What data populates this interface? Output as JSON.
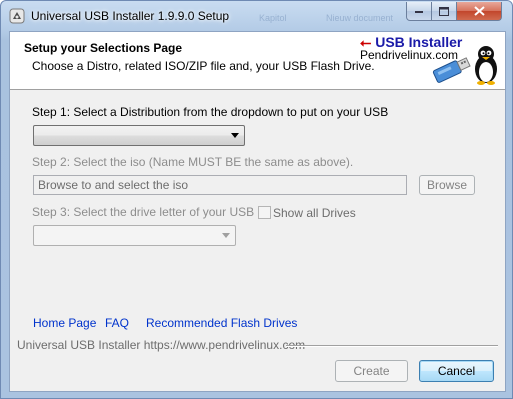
{
  "window": {
    "title": "Universal USB Installer 1.9.9.0 Setup",
    "background_ghost": [
      "Kapitol",
      "Nieuw document"
    ]
  },
  "header": {
    "title": "Setup your Selections Page",
    "subtitle": "Choose a Distro, related ISO/ZIP file and, your USB Flash Drive.",
    "brand_title": "USB Installer",
    "brand_site": "Pendrivelinux.com"
  },
  "step1": {
    "label": "Step 1: Select a Distribution from the dropdown to put on your USB",
    "selected": ""
  },
  "step2": {
    "label": "Step 2: Select the iso (Name MUST BE the same as above).",
    "iso_placeholder": "Browse to and select the iso",
    "browse_label": "Browse"
  },
  "step3": {
    "label": "Step 3: Select the drive letter of your USB",
    "show_all_label": "Show all Drives",
    "selected": ""
  },
  "links": {
    "home": "Home Page",
    "faq": "FAQ",
    "recommended": "Recommended Flash Drives"
  },
  "footer": {
    "branding": "Universal USB Installer https://www.pendrivelinux.com",
    "create_label": "Create",
    "cancel_label": "Cancel"
  },
  "colors": {
    "link": "#0033cc",
    "brand_title": "#1a1aa8",
    "disabled_text": "#8d8d8d"
  }
}
